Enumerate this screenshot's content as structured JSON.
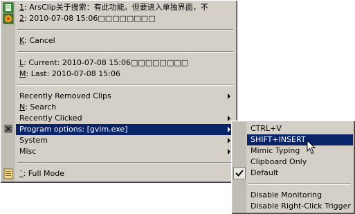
{
  "main_menu": {
    "clips": [
      {
        "accel": "1",
        "text": ": ArsClip关于搜索：有此功能。但要进入单独界面，不"
      },
      {
        "accel": "2",
        "text": ": 2010-07-08 15:06□□□□□□□□"
      }
    ],
    "cancel": {
      "accel": "K",
      "text": ": Cancel"
    },
    "current": {
      "accel": "L",
      "text": ": Current: 2010-07-08 15:06□□□□□□□□"
    },
    "last": {
      "accel": "M",
      "text": ": Last: 2010-07-08 15:06"
    },
    "recently_removed": "Recently Removed Clips",
    "search": {
      "accel": "N",
      "text": ": Search"
    },
    "recently_clicked": "Recently Clicked",
    "program_options": "Program options: [gvim.exe]",
    "system": "System",
    "misc": "Misc",
    "full_mode": {
      "accel": "`",
      "text": ": Full Mode"
    }
  },
  "sub_menu": {
    "items": [
      "CTRL+V",
      "SHIFT+INSERT",
      "Mimic Typing",
      "Clipboard Only",
      "Default"
    ],
    "disable_monitoring": "Disable Monitoring",
    "disable_right_click": "Disable Right-Click Trigger"
  }
}
